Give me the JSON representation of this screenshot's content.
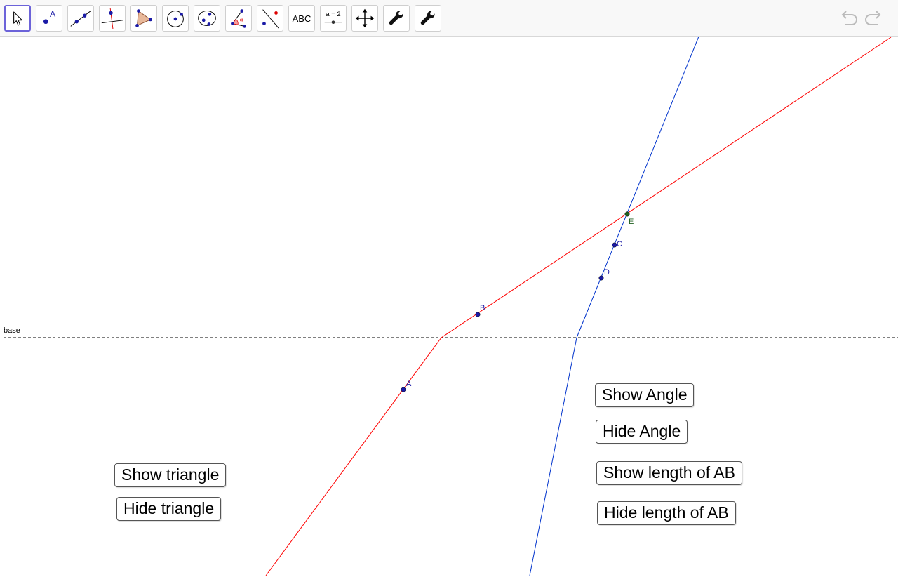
{
  "toolbar": {
    "tools": [
      {
        "name": "move",
        "icon": "pointer-arrow-icon"
      },
      {
        "name": "point",
        "icon": "point-icon",
        "label": "A"
      },
      {
        "name": "line",
        "icon": "line-icon"
      },
      {
        "name": "perpendicular",
        "icon": "perpendicular-line-icon"
      },
      {
        "name": "polygon",
        "icon": "polygon-icon"
      },
      {
        "name": "circle",
        "icon": "circle-center-point-icon"
      },
      {
        "name": "ellipse",
        "icon": "ellipse-icon"
      },
      {
        "name": "angle",
        "icon": "angle-icon",
        "label": "α"
      },
      {
        "name": "reflect",
        "icon": "reflect-about-line-icon"
      },
      {
        "name": "text",
        "icon": "text-icon",
        "label": "ABC"
      },
      {
        "name": "slider",
        "icon": "slider-icon",
        "label": "a = 2"
      },
      {
        "name": "move-graphics",
        "icon": "move-graphics-view-icon"
      },
      {
        "name": "custom-tool-1",
        "icon": "wrench-icon"
      },
      {
        "name": "custom-tool-2",
        "icon": "wrench-icon"
      }
    ],
    "undo_icon": "undo-icon",
    "redo_icon": "redo-icon"
  },
  "canvas": {
    "base_label": "base",
    "points": {
      "A": "A",
      "B": "B",
      "C": "C",
      "D": "D",
      "E": "E"
    },
    "colors": {
      "red_line": "#ff0000",
      "blue_line": "#0000cc",
      "point": "#0000aa",
      "intersection": "#006400",
      "base_line": "#000000"
    }
  },
  "buttons": {
    "show_triangle": "Show triangle",
    "hide_triangle": "Hide triangle",
    "show_angle": "Show Angle",
    "hide_angle": "Hide Angle",
    "show_length": "Show length of AB",
    "hide_length": "Hide length of AB"
  }
}
